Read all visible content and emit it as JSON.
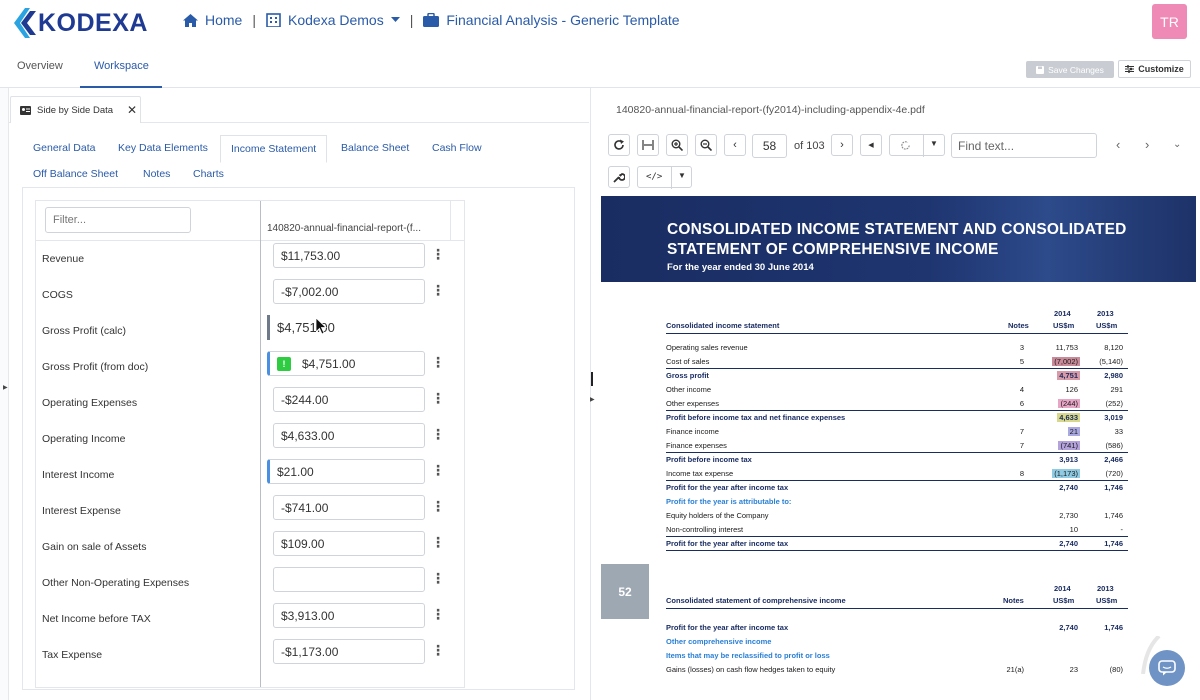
{
  "brand": {
    "name": "KODEXA"
  },
  "breadcrumb": {
    "home": "Home",
    "org": "Kodexa Demos",
    "project": "Financial Analysis - Generic Template"
  },
  "user": {
    "initials": "TR",
    "avatar_color": "#ef89b5"
  },
  "page_tabs": {
    "overview": "Overview",
    "workspace": "Workspace"
  },
  "actions": {
    "save": "Save Changes",
    "customize": "Customize"
  },
  "panel": {
    "tab_label": "Side by Side Data"
  },
  "data_tabs": [
    "General Data",
    "Key Data Elements",
    "Income Statement",
    "Balance Sheet",
    "Cash Flow",
    "Off Balance Sheet",
    "Notes",
    "Charts"
  ],
  "active_data_tab": "Income Statement",
  "grid": {
    "filter_placeholder": "Filter...",
    "column_header": "140820-annual-financial-report-(f...",
    "rows": [
      {
        "label": "Revenue",
        "value": "$11,753.00"
      },
      {
        "label": "COGS",
        "value": "-$7,002.00"
      },
      {
        "label": "Gross Profit (calc)",
        "value": "$4,751.00"
      },
      {
        "label": "Gross Profit (from doc)",
        "value": "$4,751.00"
      },
      {
        "label": "Operating Expenses",
        "value": "-$244.00"
      },
      {
        "label": "Operating Income",
        "value": "$4,633.00"
      },
      {
        "label": "Interest Income",
        "value": "$21.00"
      },
      {
        "label": "Interest Expense",
        "value": "-$741.00"
      },
      {
        "label": "Gain on sale of Assets",
        "value": "$109.00"
      },
      {
        "label": "Other Non-Operating Expenses",
        "value": ""
      },
      {
        "label": "Net Income before TAX",
        "value": "$3,913.00"
      },
      {
        "label": "Tax Expense",
        "value": "-$1,173.00"
      }
    ]
  },
  "viewer": {
    "file_name": "140820-annual-financial-report-(fy2014)-including-appendix-4e.pdf",
    "page": "58",
    "of_pages": "of 103",
    "find_placeholder": "Find text..."
  },
  "document": {
    "heading": "CONSOLIDATED INCOME STATEMENT AND CONSOLIDATED STATEMENT OF COMPREHENSIVE INCOME",
    "subheading": "For the year ended 30 June 2014",
    "col_2014": "2014",
    "col_2013": "2013",
    "unit": "US$m",
    "notes_label": "Notes",
    "table1_title": "Consolidated income statement",
    "table1": [
      {
        "label": "Operating sales revenue",
        "note": "3",
        "y2014": "11,753",
        "y2013": "8,120",
        "style": ""
      },
      {
        "label": "Cost of sales",
        "note": "5",
        "y2014": "(7,002)",
        "y2013": "(5,140)",
        "style": "",
        "hl": "#c98a9a"
      },
      {
        "label": "Gross profit",
        "note": "",
        "y2014": "4,751",
        "y2013": "2,980",
        "style": "b",
        "hl": "#d99aa8"
      },
      {
        "label": "Other income",
        "note": "4",
        "y2014": "126",
        "y2013": "291",
        "style": ""
      },
      {
        "label": "Other expenses",
        "note": "6",
        "y2014": "(244)",
        "y2013": "(252)",
        "style": "",
        "hl": "#e8a6c6"
      },
      {
        "label": "Profit before income tax and net finance expenses",
        "note": "",
        "y2014": "4,633",
        "y2013": "3,019",
        "style": "b",
        "hl": "#d8d88a"
      },
      {
        "label": "Finance income",
        "note": "7",
        "y2014": "21",
        "y2013": "33",
        "style": "",
        "hl": "#a9a8e0"
      },
      {
        "label": "Finance expenses",
        "note": "7",
        "y2014": "(741)",
        "y2013": "(586)",
        "style": "",
        "hl": "#b3a2dc"
      },
      {
        "label": "Profit before income tax",
        "note": "",
        "y2014": "3,913",
        "y2013": "2,466",
        "style": "b"
      },
      {
        "label": "Income tax expense",
        "note": "8",
        "y2014": "(1,173)",
        "y2013": "(720)",
        "style": "",
        "hl": "#8fcbe3"
      },
      {
        "label": "Profit for the year after income tax",
        "note": "",
        "y2014": "2,740",
        "y2013": "1,746",
        "style": "b"
      },
      {
        "label": "Profit for the year is attributable to:",
        "note": "",
        "y2014": "",
        "y2013": "",
        "style": "blue"
      },
      {
        "label": "Equity holders of the Company",
        "note": "",
        "y2014": "2,730",
        "y2013": "1,746",
        "style": ""
      },
      {
        "label": "Non-controlling interest",
        "note": "",
        "y2014": "10",
        "y2013": "-",
        "style": ""
      },
      {
        "label": "Profit for the year after income tax",
        "note": "",
        "y2014": "2,740",
        "y2013": "1,746",
        "style": "b"
      }
    ],
    "page_number": "52",
    "table2_title": "Consolidated statement of comprehensive income",
    "table2": [
      {
        "label": "Profit for the year after income tax",
        "note": "",
        "y2014": "2,740",
        "y2013": "1,746",
        "style": "b"
      },
      {
        "label": "Other comprehensive income",
        "note": "",
        "y2014": "",
        "y2013": "",
        "style": "blue"
      },
      {
        "label": "Items that may be reclassified to profit or loss",
        "note": "",
        "y2014": "",
        "y2013": "",
        "style": "blue"
      },
      {
        "label": "Gains (losses) on cash flow hedges taken to equity",
        "note": "21(a)",
        "y2014": "23",
        "y2013": "(80)",
        "style": ""
      }
    ]
  }
}
